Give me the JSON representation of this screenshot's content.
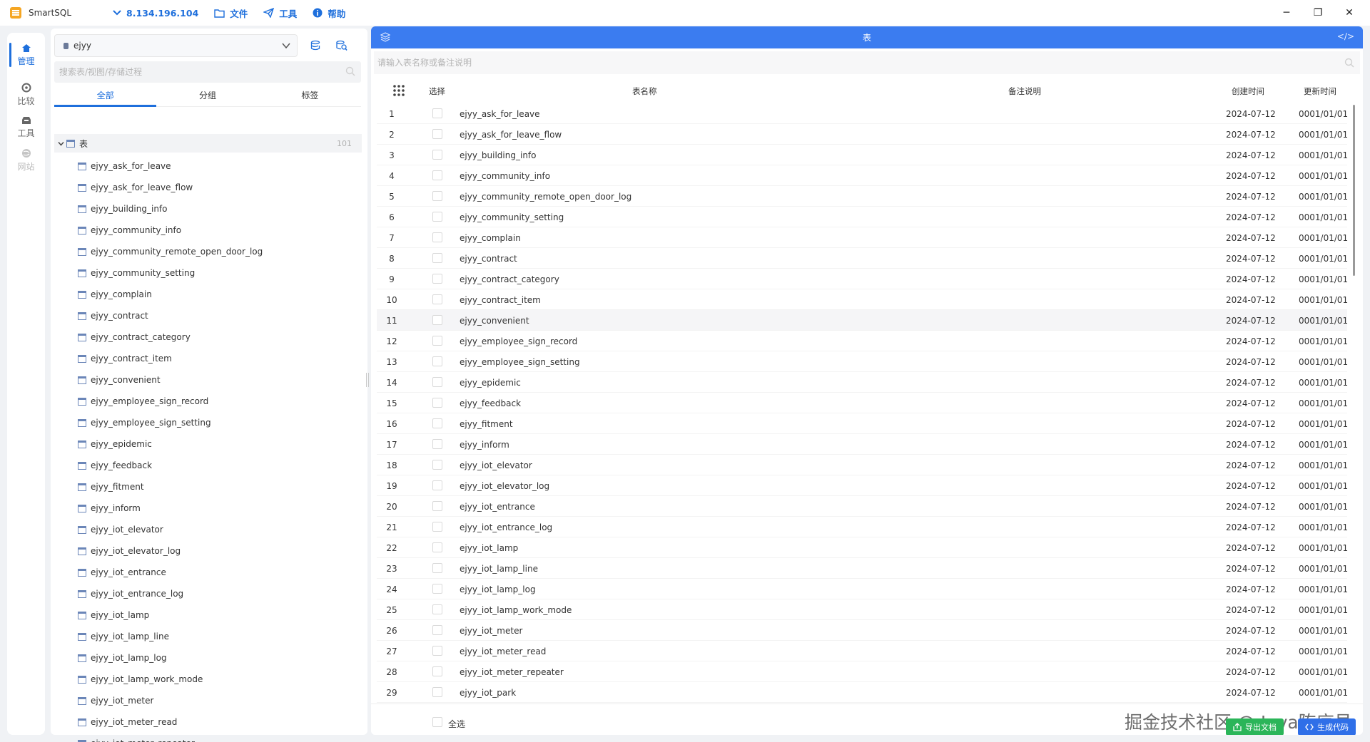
{
  "app": {
    "name": "SmartSQL",
    "connection": "8.134.196.104",
    "menu": [
      {
        "label": "文件",
        "icon": "folder-icon"
      },
      {
        "label": "工具",
        "icon": "send-icon"
      },
      {
        "label": "帮助",
        "icon": "info-icon"
      }
    ],
    "window_controls": {
      "minimize": "─",
      "restore": "❐",
      "close": "✕"
    }
  },
  "rail": {
    "items": [
      {
        "label": "管理",
        "icon": "home-icon",
        "state": "active"
      },
      {
        "label": "比较",
        "icon": "compare-icon",
        "state": "normal"
      },
      {
        "label": "工具",
        "icon": "toolbox-icon",
        "state": "normal"
      },
      {
        "label": "网站",
        "icon": "globe-icon",
        "state": "disabled"
      }
    ]
  },
  "sidebar": {
    "database": "ejyy",
    "search_placeholder": "搜索表/视图/存储过程",
    "tabs": [
      "全部",
      "分组",
      "标签"
    ],
    "active_tab": 0,
    "tree_root": {
      "label": "表",
      "count": "101"
    },
    "tables": [
      "ejyy_ask_for_leave",
      "ejyy_ask_for_leave_flow",
      "ejyy_building_info",
      "ejyy_community_info",
      "ejyy_community_remote_open_door_log",
      "ejyy_community_setting",
      "ejyy_complain",
      "ejyy_contract",
      "ejyy_contract_category",
      "ejyy_contract_item",
      "ejyy_convenient",
      "ejyy_employee_sign_record",
      "ejyy_employee_sign_setting",
      "ejyy_epidemic",
      "ejyy_feedback",
      "ejyy_fitment",
      "ejyy_inform",
      "ejyy_iot_elevator",
      "ejyy_iot_elevator_log",
      "ejyy_iot_entrance",
      "ejyy_iot_entrance_log",
      "ejyy_iot_lamp",
      "ejyy_iot_lamp_line",
      "ejyy_iot_lamp_log",
      "ejyy_iot_lamp_work_mode",
      "ejyy_iot_meter",
      "ejyy_iot_meter_read",
      "ejyy_iot_meter_repeater"
    ]
  },
  "main": {
    "header_title": "表",
    "code_icon_label": "</>",
    "filter_placeholder": "请输入表名称或备注说明",
    "columns": {
      "select": "选择",
      "name": "表名称",
      "comment": "备注说明",
      "created": "创建时间",
      "updated": "更新时间"
    },
    "highlighted_row": 11,
    "rows": [
      {
        "no": "1",
        "name": "ejyy_ask_for_leave",
        "comment": "",
        "created": "2024-07-12",
        "updated": "0001/01/01"
      },
      {
        "no": "2",
        "name": "ejyy_ask_for_leave_flow",
        "comment": "",
        "created": "2024-07-12",
        "updated": "0001/01/01"
      },
      {
        "no": "3",
        "name": "ejyy_building_info",
        "comment": "",
        "created": "2024-07-12",
        "updated": "0001/01/01"
      },
      {
        "no": "4",
        "name": "ejyy_community_info",
        "comment": "",
        "created": "2024-07-12",
        "updated": "0001/01/01"
      },
      {
        "no": "5",
        "name": "ejyy_community_remote_open_door_log",
        "comment": "",
        "created": "2024-07-12",
        "updated": "0001/01/01"
      },
      {
        "no": "6",
        "name": "ejyy_community_setting",
        "comment": "",
        "created": "2024-07-12",
        "updated": "0001/01/01"
      },
      {
        "no": "7",
        "name": "ejyy_complain",
        "comment": "",
        "created": "2024-07-12",
        "updated": "0001/01/01"
      },
      {
        "no": "8",
        "name": "ejyy_contract",
        "comment": "",
        "created": "2024-07-12",
        "updated": "0001/01/01"
      },
      {
        "no": "9",
        "name": "ejyy_contract_category",
        "comment": "",
        "created": "2024-07-12",
        "updated": "0001/01/01"
      },
      {
        "no": "10",
        "name": "ejyy_contract_item",
        "comment": "",
        "created": "2024-07-12",
        "updated": "0001/01/01"
      },
      {
        "no": "11",
        "name": "ejyy_convenient",
        "comment": "",
        "created": "2024-07-12",
        "updated": "0001/01/01"
      },
      {
        "no": "12",
        "name": "ejyy_employee_sign_record",
        "comment": "",
        "created": "2024-07-12",
        "updated": "0001/01/01"
      },
      {
        "no": "13",
        "name": "ejyy_employee_sign_setting",
        "comment": "",
        "created": "2024-07-12",
        "updated": "0001/01/01"
      },
      {
        "no": "14",
        "name": "ejyy_epidemic",
        "comment": "",
        "created": "2024-07-12",
        "updated": "0001/01/01"
      },
      {
        "no": "15",
        "name": "ejyy_feedback",
        "comment": "",
        "created": "2024-07-12",
        "updated": "0001/01/01"
      },
      {
        "no": "16",
        "name": "ejyy_fitment",
        "comment": "",
        "created": "2024-07-12",
        "updated": "0001/01/01"
      },
      {
        "no": "17",
        "name": "ejyy_inform",
        "comment": "",
        "created": "2024-07-12",
        "updated": "0001/01/01"
      },
      {
        "no": "18",
        "name": "ejyy_iot_elevator",
        "comment": "",
        "created": "2024-07-12",
        "updated": "0001/01/01"
      },
      {
        "no": "19",
        "name": "ejyy_iot_elevator_log",
        "comment": "",
        "created": "2024-07-12",
        "updated": "0001/01/01"
      },
      {
        "no": "20",
        "name": "ejyy_iot_entrance",
        "comment": "",
        "created": "2024-07-12",
        "updated": "0001/01/01"
      },
      {
        "no": "21",
        "name": "ejyy_iot_entrance_log",
        "comment": "",
        "created": "2024-07-12",
        "updated": "0001/01/01"
      },
      {
        "no": "22",
        "name": "ejyy_iot_lamp",
        "comment": "",
        "created": "2024-07-12",
        "updated": "0001/01/01"
      },
      {
        "no": "23",
        "name": "ejyy_iot_lamp_line",
        "comment": "",
        "created": "2024-07-12",
        "updated": "0001/01/01"
      },
      {
        "no": "24",
        "name": "ejyy_iot_lamp_log",
        "comment": "",
        "created": "2024-07-12",
        "updated": "0001/01/01"
      },
      {
        "no": "25",
        "name": "ejyy_iot_lamp_work_mode",
        "comment": "",
        "created": "2024-07-12",
        "updated": "0001/01/01"
      },
      {
        "no": "26",
        "name": "ejyy_iot_meter",
        "comment": "",
        "created": "2024-07-12",
        "updated": "0001/01/01"
      },
      {
        "no": "27",
        "name": "ejyy_iot_meter_read",
        "comment": "",
        "created": "2024-07-12",
        "updated": "0001/01/01"
      },
      {
        "no": "28",
        "name": "ejyy_iot_meter_repeater",
        "comment": "",
        "created": "2024-07-12",
        "updated": "0001/01/01"
      },
      {
        "no": "29",
        "name": "ejyy_iot_park",
        "comment": "",
        "created": "2024-07-12",
        "updated": "0001/01/01"
      }
    ],
    "footer": {
      "select_all": "全选",
      "export_label": "导出文档",
      "generate_label": "生成代码",
      "watermark": "掘金技术社区 @ Java陈序员"
    }
  },
  "colors": {
    "accent": "#3b7cf0",
    "link": "#1e6fdc",
    "export_button": "#2bb559",
    "generate_button": "#2f6fe8",
    "app_logo": "#f5a623"
  }
}
